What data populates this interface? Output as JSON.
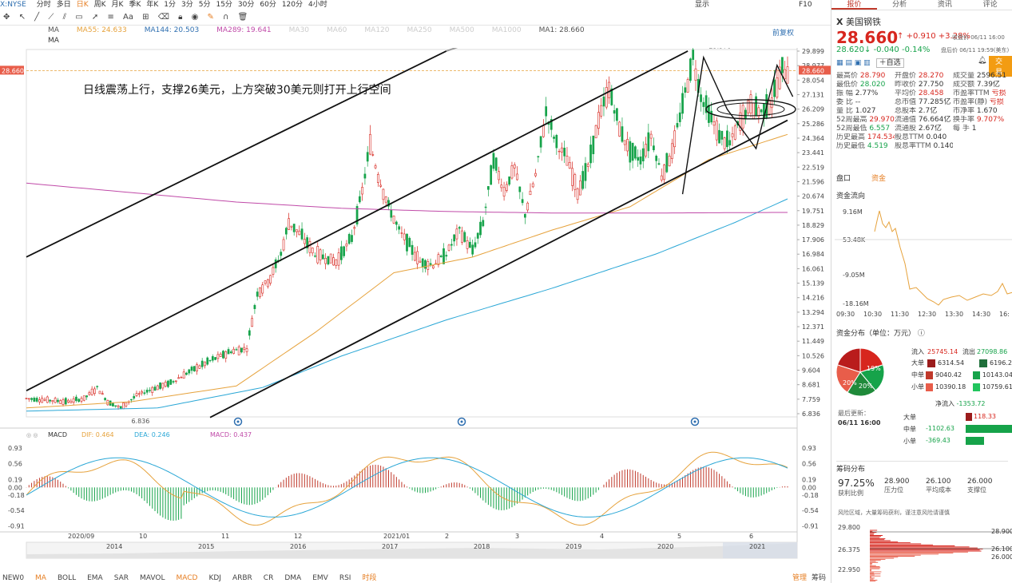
{
  "symbol": "X:NYSE",
  "topbar": [
    "分时",
    "多日",
    "日K",
    "周K",
    "月K",
    "季K",
    "年K",
    "1分",
    "3分",
    "5分",
    "15分",
    "30分",
    "60分",
    "120分",
    "4小时"
  ],
  "topbar_right": [
    "显示",
    "F10"
  ],
  "toolbar_active": "日K",
  "chart_header": {
    "line1": [
      "MA",
      "MA55: 24.633",
      "MA144: 20.503",
      "MA289: 19.641",
      "MA30",
      "MA60",
      "MA120",
      "MA250",
      "MA500",
      "MA1000",
      "MA1: 28.660"
    ],
    "line1_right": "前复权",
    "line2": [
      "MA"
    ]
  },
  "annotation": "日线震荡上行，支撑26美元，上方突破30美元则打开上行空间",
  "price_labels": {
    "high": "29.970",
    "low": "6.836",
    "last": "28.660"
  },
  "y_ticks": [
    "29.899",
    "28.977",
    "28.054",
    "27.131",
    "26.209",
    "25.286",
    "24.364",
    "23.441",
    "22.519",
    "21.596",
    "20.674",
    "19.751",
    "18.829",
    "17.906",
    "16.984",
    "16.061",
    "15.139",
    "14.216",
    "13.294",
    "12.371",
    "11.449",
    "10.526",
    "9.604",
    "8.681",
    "7.759",
    "6.836"
  ],
  "macd": {
    "labels": [
      "MACD",
      "DIF: 0.464",
      "DEA: 0.246",
      "MACD: 0.437"
    ],
    "ticks": [
      "0.93",
      "0.56",
      "0.19",
      "0.00",
      "-0.18",
      "-0.54",
      "-0.91"
    ]
  },
  "x_labels": [
    "2020/09",
    "10",
    "11",
    "12",
    "2021/01",
    "2",
    "3",
    "4",
    "5",
    "6"
  ],
  "year_labels": [
    "2014",
    "2015",
    "2016",
    "2017",
    "2018",
    "2019",
    "2020",
    "2021"
  ],
  "bottombar": [
    "NEW0",
    "MA",
    "BOLL",
    "EMA",
    "SAR",
    "MAVOL",
    "MACD",
    "KDJ",
    "ARBR",
    "CR",
    "DMA",
    "EMV",
    "RSI",
    "时段"
  ],
  "bottombar_active": [
    "MA",
    "MACD",
    "时段"
  ],
  "bottombar_right": [
    "管理",
    "筹码"
  ],
  "chart_data": {
    "type": "candlestick",
    "title": "",
    "ylim": [
      6.836,
      29.899
    ],
    "x_range": [
      "2020/09",
      "2021/06"
    ],
    "close_points": [
      [
        0,
        7.8
      ],
      [
        8,
        7.7
      ],
      [
        16,
        7.6
      ],
      [
        22,
        7.8
      ],
      [
        27,
        8.5
      ],
      [
        31,
        7.6
      ],
      [
        36,
        7.2
      ],
      [
        42,
        8.0
      ],
      [
        48,
        8.4
      ],
      [
        55,
        8.8
      ],
      [
        62,
        9.5
      ],
      [
        70,
        10.2
      ],
      [
        78,
        10.8
      ],
      [
        84,
        11.0
      ],
      [
        88,
        14.5
      ],
      [
        93,
        15.5
      ],
      [
        97,
        17.0
      ],
      [
        100,
        19.0
      ],
      [
        104,
        18.3
      ],
      [
        110,
        17.0
      ],
      [
        118,
        16.5
      ],
      [
        124,
        18.0
      ],
      [
        128,
        21.0
      ],
      [
        131,
        24.0
      ],
      [
        134,
        22.0
      ],
      [
        138,
        20.0
      ],
      [
        142,
        18.5
      ],
      [
        146,
        17.5
      ],
      [
        150,
        16.5
      ],
      [
        155,
        16.3
      ],
      [
        160,
        17.0
      ],
      [
        165,
        18.5
      ],
      [
        170,
        17.2
      ],
      [
        174,
        19.0
      ],
      [
        178,
        23.0
      ],
      [
        182,
        21.0
      ],
      [
        186,
        22.5
      ],
      [
        190,
        19.5
      ],
      [
        194,
        22.0
      ],
      [
        198,
        26.0
      ],
      [
        202,
        24.0
      ],
      [
        206,
        23.0
      ],
      [
        210,
        21.0
      ],
      [
        214,
        22.5
      ],
      [
        218,
        25.5
      ],
      [
        222,
        27.5
      ],
      [
        226,
        25.0
      ],
      [
        230,
        23.5
      ],
      [
        234,
        23.0
      ],
      [
        238,
        24.5
      ],
      [
        242,
        22.0
      ],
      [
        246,
        23.5
      ],
      [
        250,
        26.5
      ],
      [
        254,
        29.5
      ],
      [
        257,
        27.0
      ],
      [
        260,
        26.0
      ],
      [
        264,
        24.5
      ],
      [
        268,
        24.0
      ],
      [
        272,
        25.5
      ],
      [
        276,
        26.5
      ],
      [
        280,
        26.0
      ],
      [
        284,
        26.8
      ],
      [
        288,
        28.7
      ],
      [
        290,
        28.66
      ]
    ],
    "n": 290,
    "ma_series": [
      {
        "name": "MA55",
        "points": [
          [
            0,
            7.2
          ],
          [
            40,
            7.6
          ],
          [
            80,
            8.6
          ],
          [
            110,
            12.0
          ],
          [
            140,
            15.8
          ],
          [
            170,
            16.8
          ],
          [
            200,
            18.5
          ],
          [
            230,
            20.0
          ],
          [
            260,
            23.0
          ],
          [
            290,
            24.6
          ]
        ]
      },
      {
        "name": "MA144",
        "points": [
          [
            0,
            7.0
          ],
          [
            50,
            7.2
          ],
          [
            90,
            8.5
          ],
          [
            120,
            10.5
          ],
          [
            160,
            12.8
          ],
          [
            200,
            14.8
          ],
          [
            240,
            17.0
          ],
          [
            270,
            19.0
          ],
          [
            290,
            20.5
          ]
        ]
      },
      {
        "name": "MA289",
        "points": [
          [
            0,
            21.5
          ],
          [
            40,
            20.9
          ],
          [
            80,
            20.3
          ],
          [
            120,
            19.9
          ],
          [
            160,
            19.7
          ],
          [
            200,
            19.6
          ],
          [
            240,
            19.6
          ],
          [
            290,
            19.64
          ]
        ]
      }
    ],
    "trend_lines": [
      [
        [
          0,
          16.8
        ],
        [
          160,
          29.9
        ]
      ],
      [
        [
          0,
          8.3
        ],
        [
          252,
          29.9
        ]
      ],
      [
        [
          70,
          6.6
        ],
        [
          290,
          25.5
        ]
      ]
    ]
  },
  "quote": {
    "tabs": [
      "报价",
      "分析",
      "资讯",
      "评论"
    ],
    "name": "美国钢铁",
    "code_prefix": "X",
    "price": "28.660",
    "change": "+0.910",
    "change_pct": "+3.28%",
    "close_time": "收盘价 06/11 16:00",
    "after_price": "28.620",
    "after_change": "-0.040",
    "after_pct": "-0.14%",
    "after_time": "盘后价 06/11 19:59(美东)",
    "self_select": "自选",
    "trade": "交易",
    "grid": [
      [
        "最高价",
        "28.790",
        "开盘价",
        "28.270",
        "成交量",
        "2596.51"
      ],
      [
        "最低价",
        "28.020",
        "昨收价",
        "27.750",
        "成交额",
        "7.39亿"
      ],
      [
        "振 幅",
        "2.77%",
        "平均价",
        "28.458",
        "市盈率TTM",
        "亏损"
      ],
      [
        "委 比",
        "--",
        "总市值",
        "77.285亿",
        "市盈率(静)",
        "亏损"
      ],
      [
        "量 比",
        "1.027",
        "总股本",
        "2.7亿",
        "市净率",
        "1.670"
      ],
      [
        "52周最高",
        "29.970",
        "流通值",
        "76.664亿",
        "换手率",
        "9.707%"
      ],
      [
        "52周最低",
        "6.557",
        "流通股",
        "2.67亿",
        "每 手",
        "1"
      ],
      [
        "历史最高",
        "174.534",
        "股息TTM",
        "0.040",
        "",
        ""
      ],
      [
        "历史最低",
        "4.519",
        "股息率TTM",
        "0.140%",
        "",
        ""
      ]
    ],
    "subtabs": [
      "盘口",
      "资金"
    ],
    "fund_flow_title": "资金流向",
    "fund_flow_ticks": [
      "9.16M",
      "53.48K",
      "-9.05M",
      "-18.16M"
    ],
    "fund_flow_times": [
      "09:30",
      "10:30",
      "11:30",
      "12:30",
      "13:30",
      "14:30",
      "16:"
    ],
    "fund_dist_title": "资金分布（单位：万元）",
    "flow_in_label": "流入",
    "flow_in": "25745.14",
    "flow_out_label": "流出",
    "flow_out": "27098.86",
    "dist_rows": [
      [
        "大单",
        "6314.54",
        "6196.2"
      ],
      [
        "中单",
        "9040.42",
        "10143.04"
      ],
      [
        "小单",
        "10390.18",
        "10759.61"
      ]
    ],
    "net_label": "净流入",
    "net_value": "-1353.72",
    "update_label": "最后更新：",
    "update_time": "06/11 16:00",
    "net_rows": [
      [
        "大单",
        "118.33"
      ],
      [
        "中单",
        "-1102.63"
      ],
      [
        "小单",
        "-369.43"
      ]
    ],
    "pie": {
      "slices": [
        20,
        19,
        20,
        21,
        20
      ],
      "labels": [
        "19%",
        "20%",
        "20%"
      ]
    },
    "chip_title": "筹码分布",
    "chip_stats": [
      [
        "97.25%",
        "获利比例"
      ],
      [
        "28.900",
        "压力位"
      ],
      [
        "26.100",
        "平均成本"
      ],
      [
        "26.000",
        "支撑位"
      ]
    ],
    "chip_note": "风险区域，大量筹码获利，谨注意风险请谨慎",
    "chip_ticks": [
      "29.800",
      "26.375",
      "22.950"
    ],
    "chip_marks": [
      "28.900",
      "26.100",
      "26.000"
    ]
  }
}
